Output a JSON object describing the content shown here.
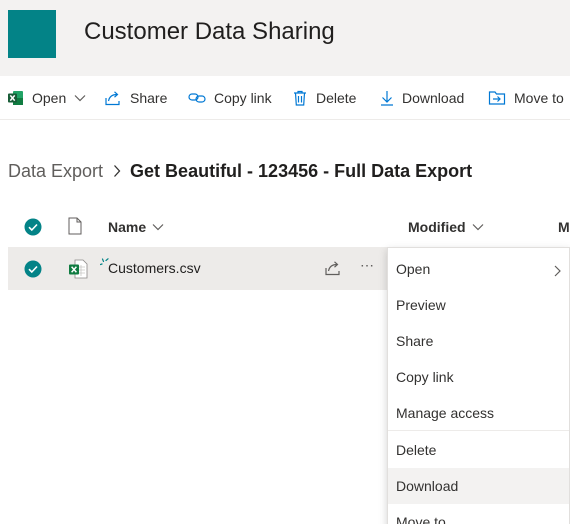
{
  "site": {
    "title": "Customer Data Sharing",
    "logo_color": "#038387"
  },
  "command_bar": {
    "open": "Open",
    "share": "Share",
    "copy_link": "Copy link",
    "delete": "Delete",
    "download": "Download",
    "move_to": "Move to"
  },
  "breadcrumb": {
    "root": "Data Export",
    "current": "Get Beautiful - 123456 - Full Data Export"
  },
  "list": {
    "columns": {
      "name": "Name",
      "modified": "Modified",
      "more": "M"
    },
    "rows": [
      {
        "name": "Customers.csv",
        "selected": true
      }
    ]
  },
  "context_menu": {
    "items": [
      "Open",
      "Preview",
      "Share",
      "Copy link",
      "Manage access",
      "Delete",
      "Download",
      "Move to"
    ],
    "highlighted": "Download"
  },
  "colors": {
    "accent": "#038387",
    "excel": "#107c41",
    "brand_blue": "#0078d4"
  },
  "icons": [
    "excel-icon",
    "share-icon",
    "link-icon",
    "trash-icon",
    "download-icon",
    "move-icon",
    "chevron-down-icon",
    "chevron-right-icon",
    "check-circle-icon",
    "document-icon",
    "more-icon"
  ]
}
